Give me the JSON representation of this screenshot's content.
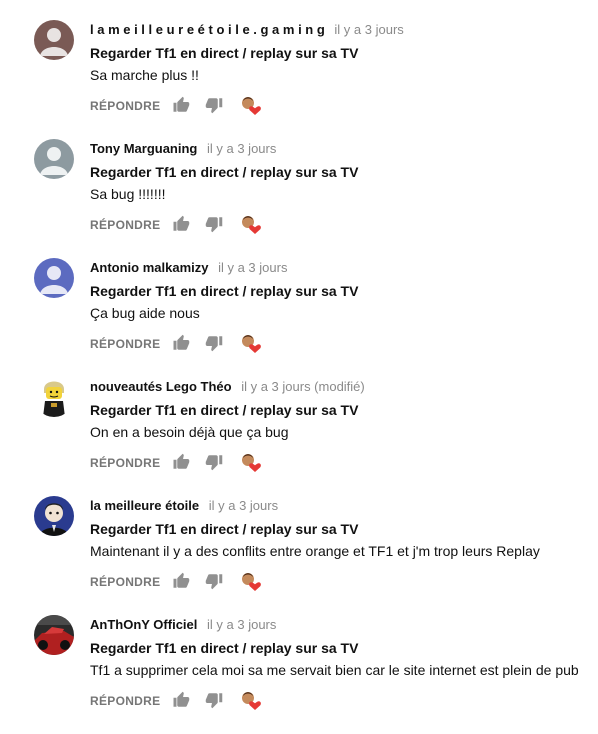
{
  "comments": [
    {
      "author": "l a m e i l l e u r e é t o i l e . g a m i n g",
      "time": "il y a 3 jours",
      "video_title": "Regarder Tf1 en direct / replay sur sa TV",
      "text": "Sa marche plus !!",
      "reply_label": "RÉPONDRE",
      "avatar_color": "#7a5a55"
    },
    {
      "author": "Tony Marguaning",
      "time": "il y a 3 jours",
      "video_title": "Regarder Tf1 en direct / replay sur sa TV",
      "text": "Sa bug !!!!!!!",
      "reply_label": "RÉPONDRE",
      "avatar_color": "#8d9aa0"
    },
    {
      "author": "Antonio malkamizy",
      "time": "il y a 3 jours",
      "video_title": "Regarder Tf1 en direct / replay sur sa TV",
      "text": "Ça bug aide nous",
      "reply_label": "RÉPONDRE",
      "avatar_color": "#5c6bc0"
    },
    {
      "author": "nouveautés Lego Théo",
      "time": "il y a 3 jours (modifié)",
      "video_title": "Regarder Tf1 en direct / replay sur sa TV",
      "text": "On en a besoin déjà que ça bug",
      "reply_label": "RÉPONDRE",
      "avatar_color": "#ffffff"
    },
    {
      "author": "la meilleure étoile",
      "time": "il y a 3 jours",
      "video_title": "Regarder Tf1 en direct / replay sur sa TV",
      "text": "Maintenant il y a des conflits entre orange et TF1 et j'm trop leurs Replay",
      "reply_label": "RÉPONDRE",
      "avatar_color": "#2a3b8f"
    },
    {
      "author": "AnThOnY Officiel",
      "time": "il y a 3 jours",
      "video_title": "Regarder Tf1 en direct / replay sur sa TV",
      "text": "Tf1 a supprimer cela moi sa me servait bien car le site internet est plein de pub",
      "reply_label": "RÉPONDRE",
      "avatar_color": "#b02020"
    }
  ],
  "icons": {
    "like": "thumbs-up-icon",
    "dislike": "thumbs-down-icon",
    "creator_heart": "creator-heart-icon"
  },
  "colors": {
    "icon_gray": "#909090",
    "heart_red": "#e53935",
    "time_gray": "#8a8a8a"
  }
}
